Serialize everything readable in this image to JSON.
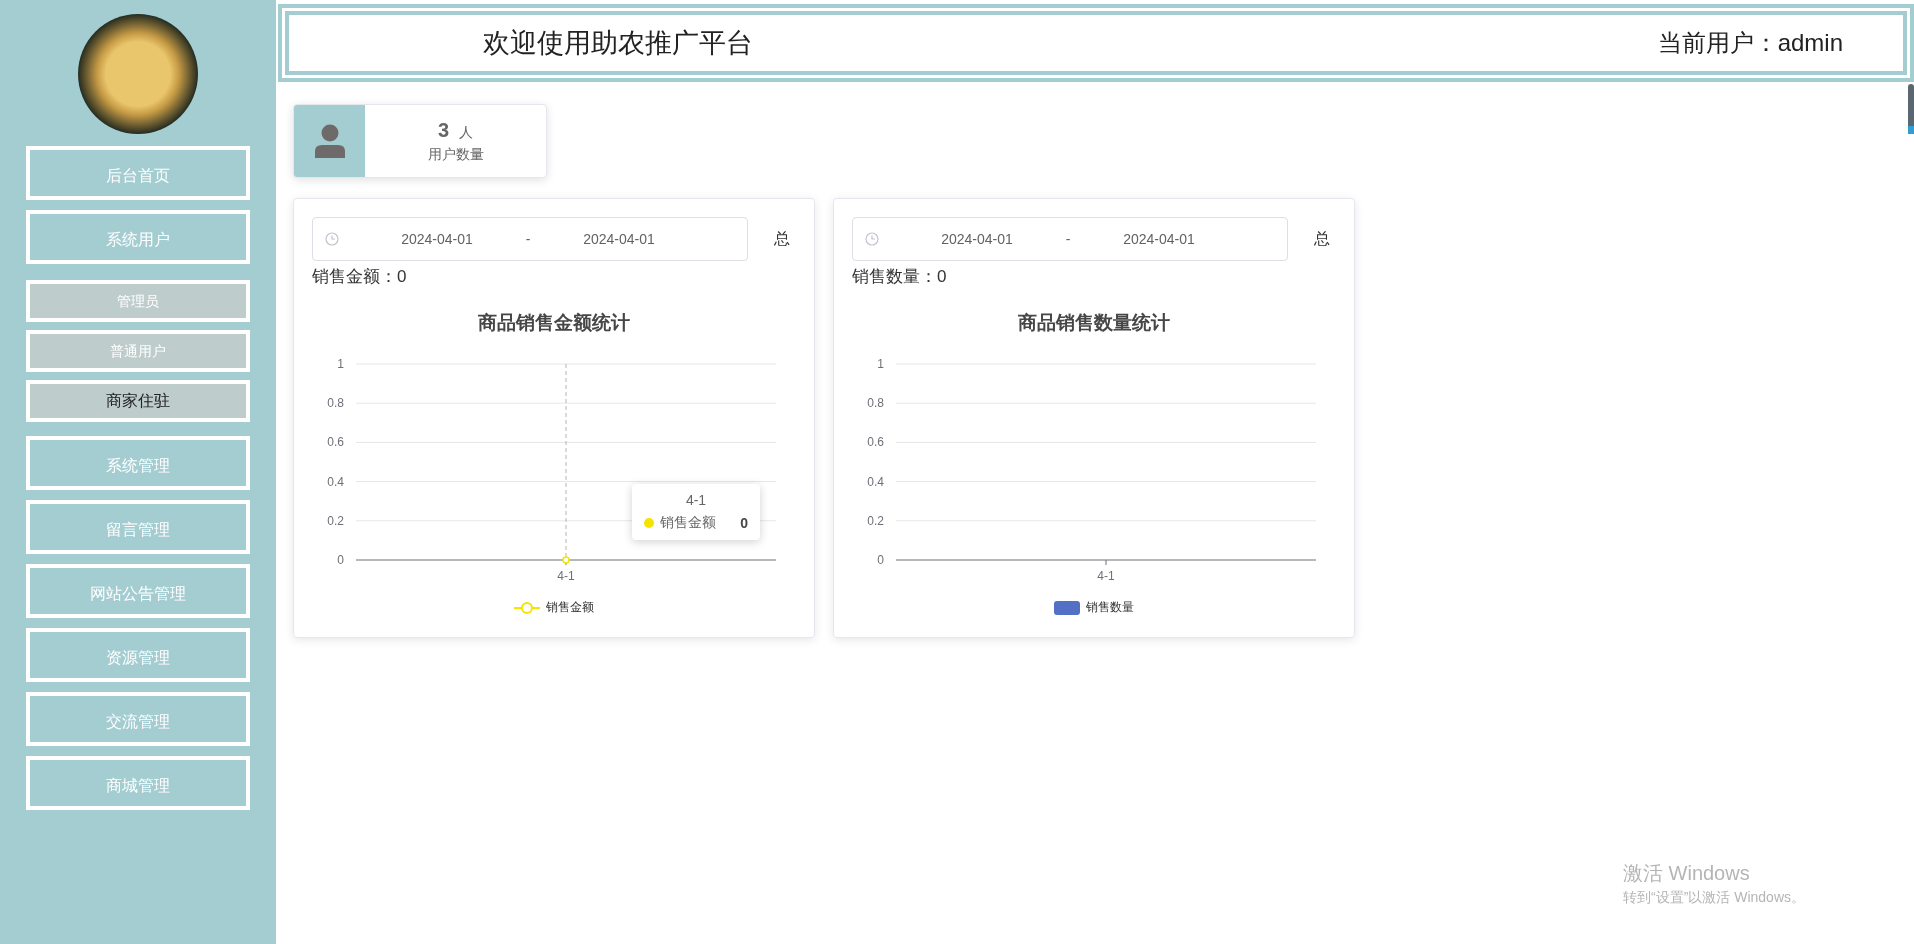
{
  "header": {
    "title": "欢迎使用助农推广平台",
    "user_label": "当前用户：admin"
  },
  "sidebar": {
    "items": [
      {
        "label": "后台首页",
        "kind": "main",
        "selected": false
      },
      {
        "label": "系统用户",
        "kind": "main",
        "selected": false
      },
      {
        "label": "管理员",
        "kind": "sub",
        "selected": false
      },
      {
        "label": "普通用户",
        "kind": "sub",
        "selected": false
      },
      {
        "label": "商家住驻",
        "kind": "sub",
        "selected": true
      },
      {
        "label": "系统管理",
        "kind": "main",
        "selected": false
      },
      {
        "label": "留言管理",
        "kind": "main",
        "selected": false
      },
      {
        "label": "网站公告管理",
        "kind": "main",
        "selected": false
      },
      {
        "label": "资源管理",
        "kind": "main",
        "selected": false
      },
      {
        "label": "交流管理",
        "kind": "main",
        "selected": false
      },
      {
        "label": "商城管理",
        "kind": "main",
        "selected": false
      }
    ]
  },
  "stats": [
    {
      "value": "3",
      "unit": "人",
      "label": "用户数量"
    }
  ],
  "charts": [
    {
      "date_range": {
        "start": "2024-04-01",
        "separator": "-",
        "end": "2024-04-01"
      },
      "total_button": "总",
      "summary": "销售金额：0",
      "chart_data": {
        "type": "line",
        "title": "商品销售金额统计",
        "grid": true,
        "categories": [
          "4-1"
        ],
        "series": [
          {
            "name": "销售金额",
            "color": "#f5e400",
            "marker": "circle",
            "values": [
              0
            ]
          }
        ],
        "ylim": [
          0,
          1
        ],
        "yticks": [
          0,
          0.2,
          0.4,
          0.6,
          0.8,
          1
        ],
        "ref_lines": [
          {
            "axis": "x",
            "value": "4-1"
          }
        ]
      },
      "tooltip": {
        "title": "4-1",
        "name": "销售金额",
        "value": "0"
      }
    },
    {
      "date_range": {
        "start": "2024-04-01",
        "separator": "-",
        "end": "2024-04-01"
      },
      "total_button": "总",
      "summary": "销售数量：0",
      "chart_data": {
        "type": "bar",
        "title": "商品销售数量统计",
        "grid": true,
        "categories": [
          "4-1"
        ],
        "series": [
          {
            "name": "销售数量",
            "color": "#5470c6",
            "values": [
              0
            ]
          }
        ],
        "ylim": [
          0,
          1
        ],
        "yticks": [
          0,
          0.2,
          0.4,
          0.6,
          0.8,
          1
        ]
      }
    }
  ],
  "os_notice": {
    "title": "激活 Windows",
    "text": "转到“设置”以激活 Windows。"
  }
}
